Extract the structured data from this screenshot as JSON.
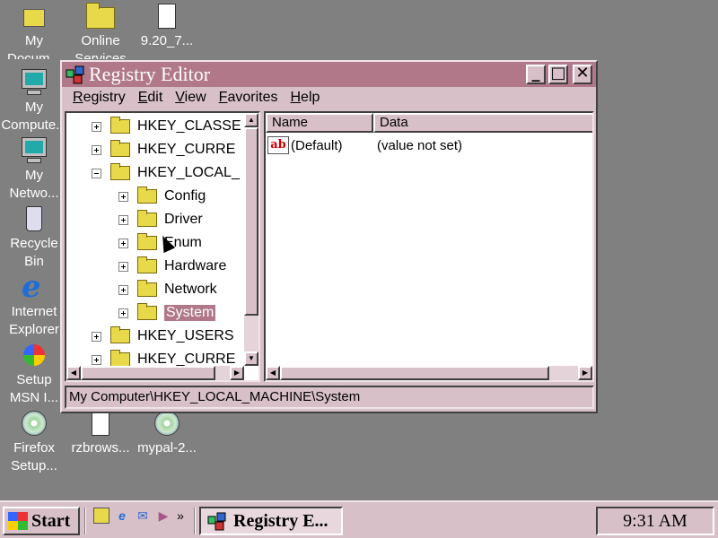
{
  "desktop": {
    "icons": [
      {
        "label": "My\nDocum..."
      },
      {
        "label": "Online\nServices"
      },
      {
        "label": "9.20_7..."
      },
      {
        "label": "My\nCompute..."
      },
      {
        "label": "My\nNetwo..."
      },
      {
        "label": "Recycle\nBin"
      },
      {
        "label": "Internet\nExplorer"
      },
      {
        "label": "Setup\nMSN I..."
      },
      {
        "label": "Firefox\nSetup..."
      },
      {
        "label": "rzbrows..."
      },
      {
        "label": "mypal-2..."
      }
    ]
  },
  "window": {
    "title": "Registry Editor",
    "controls": {
      "minimize": "_",
      "maximize": "□",
      "close": "✕"
    },
    "menu": [
      "Registry",
      "Edit",
      "View",
      "Favorites",
      "Help"
    ],
    "tree": [
      {
        "label": "HKEY_CLASSE",
        "expander": "plus"
      },
      {
        "label": "HKEY_CURRE",
        "expander": "plus"
      },
      {
        "label": "HKEY_LOCAL_",
        "expander": "minus"
      },
      {
        "label": "Config",
        "expander": "plus"
      },
      {
        "label": "Driver",
        "expander": "plus"
      },
      {
        "label": "Enum",
        "expander": "plus"
      },
      {
        "label": "Hardware",
        "expander": "plus"
      },
      {
        "label": "Network",
        "expander": "plus"
      },
      {
        "label": "System",
        "expander": "plus",
        "selected": true
      },
      {
        "label": "HKEY_USERS",
        "expander": "plus"
      },
      {
        "label": "HKEY_CURRE",
        "expander": "plus"
      }
    ],
    "list": {
      "columns": [
        "Name",
        "Data"
      ],
      "rows": [
        {
          "name": "(Default)",
          "data": "(value not set)",
          "icon": "ab"
        }
      ]
    },
    "status": "My Computer\\HKEY_LOCAL_MACHINE\\System"
  },
  "taskbar": {
    "start_label": "Start",
    "task_label": "Registry E...",
    "chevron": "»",
    "clock": "9:31 AM"
  },
  "colors": {
    "titlebar": "#b07888",
    "face": "#d8c0c8",
    "desktop": "#808080"
  }
}
